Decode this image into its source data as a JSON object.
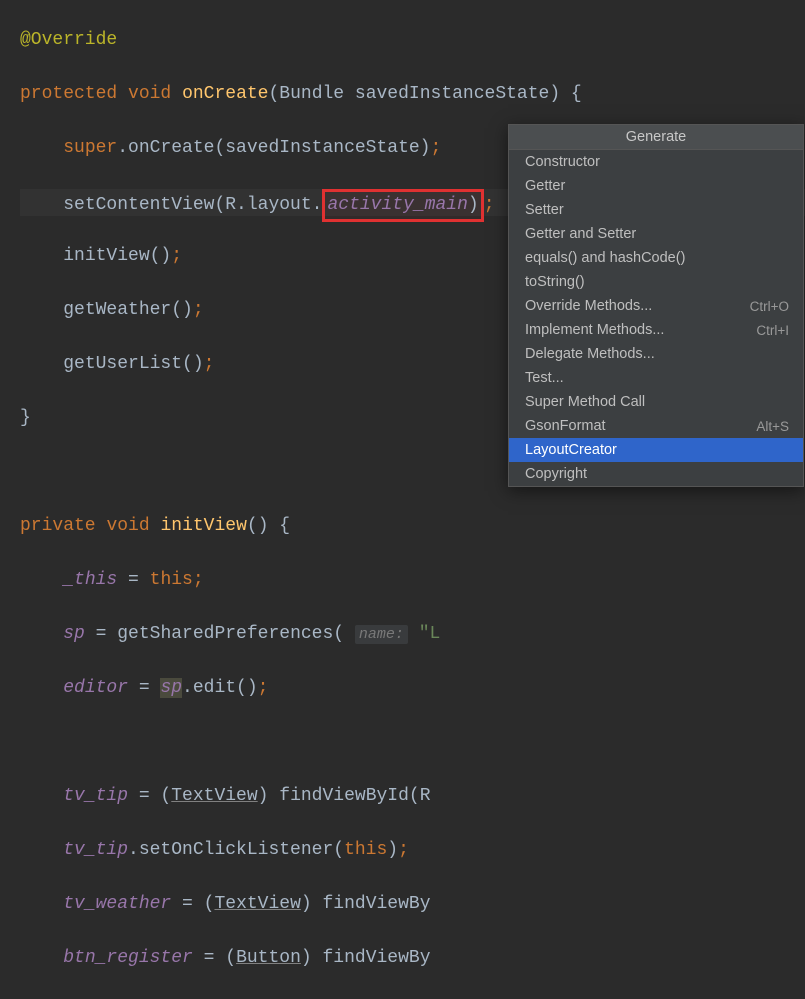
{
  "code": {
    "annotation": "@Override",
    "protected": "protected",
    "void": "void",
    "onCreate": "onCreate",
    "bundle_param": "(Bundle savedInstanceState) {",
    "super_call_pre": "super",
    "super_call_post": ".onCreate(savedInstanceState)",
    "setContentView": "setContentView(R.layout.",
    "activity_main": "activity_main",
    "close_scv": ")",
    "initView_call": "initView()",
    "getWeather_call": "getWeather()",
    "getUserList_call": "getUserList()",
    "close_brace": "}",
    "private": "private",
    "initView_def": "initView",
    "initView_par": "() {",
    "this_field": "_this",
    "this_kw": "this",
    "eq": " = ",
    "sp_field": "sp",
    "getShared_call": "getSharedPreferences( ",
    "name_hint": "name:",
    "name_value": " \"L",
    "editor_field": "editor",
    "sp_edit_pre": "sp",
    "sp_edit_post": ".edit()",
    "tv_tip": "tv_tip",
    "tv_tip_cast": " = (",
    "TextView": "TextView",
    "cast_close": ") ",
    "findViewById_R": "findViewById(R",
    "tv_tip_listener": ".setOnClickListener(",
    "close_listener": ")",
    "tv_weather": "tv_weather",
    "findViewBy": "findViewBy",
    "btn_register": "btn_register",
    "Button": "Button",
    "semi": ";"
  },
  "menu": {
    "title": "Generate",
    "items": [
      {
        "label": "Constructor",
        "shortcut": "",
        "selected": false
      },
      {
        "label": "Getter",
        "shortcut": "",
        "selected": false
      },
      {
        "label": "Setter",
        "shortcut": "",
        "selected": false
      },
      {
        "label": "Getter and Setter",
        "shortcut": "",
        "selected": false
      },
      {
        "label": "equals() and hashCode()",
        "shortcut": "",
        "selected": false
      },
      {
        "label": "toString()",
        "shortcut": "",
        "selected": false
      },
      {
        "label": "Override Methods...",
        "shortcut": "Ctrl+O",
        "selected": false
      },
      {
        "label": "Implement Methods...",
        "shortcut": "Ctrl+I",
        "selected": false
      },
      {
        "label": "Delegate Methods...",
        "shortcut": "",
        "selected": false
      },
      {
        "label": "Test...",
        "shortcut": "",
        "selected": false
      },
      {
        "label": "Super Method Call",
        "shortcut": "",
        "selected": false
      },
      {
        "label": "GsonFormat",
        "shortcut": "Alt+S",
        "selected": false
      },
      {
        "label": "LayoutCreator",
        "shortcut": "",
        "selected": true
      },
      {
        "label": "Copyright",
        "shortcut": "",
        "selected": false
      }
    ]
  }
}
